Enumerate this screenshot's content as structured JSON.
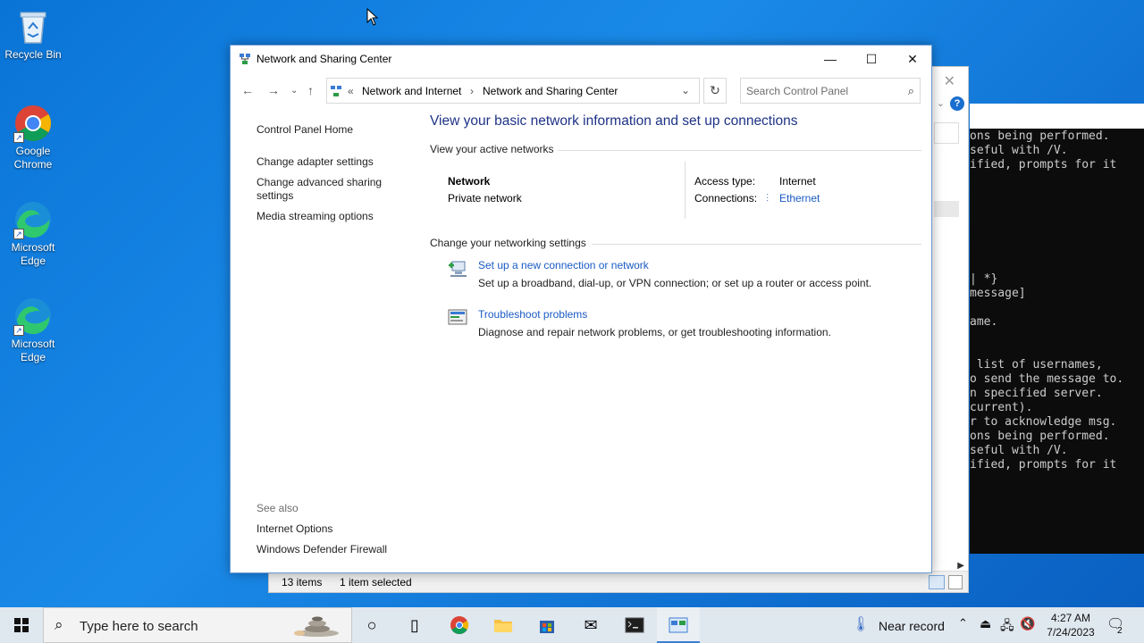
{
  "desktop": {
    "icons": [
      {
        "label": "Recycle Bin"
      },
      {
        "label": "Google Chrome"
      },
      {
        "label": "Microsoft Edge"
      },
      {
        "label": "Microsoft Edge"
      }
    ]
  },
  "console": {
    "lines": [
      "ons being performed.",
      "seful with /V.",
      "ified, prompts for it",
      "| *}",
      "message]",
      "ame.",
      " list of usernames,",
      "o send the message to.",
      "n specified server.",
      "current).",
      "r to acknowledge msg.",
      "ons being performed.",
      "seful with /V.",
      "ified, prompts for it"
    ]
  },
  "background_window": {
    "status_items": "13 items",
    "status_selected": "1 item selected"
  },
  "window": {
    "title": "Network and Sharing Center",
    "breadcrumb": {
      "prefix": "«",
      "parent": "Network and Internet",
      "separator": "›",
      "current": "Network and Sharing Center"
    },
    "search_placeholder": "Search Control Panel",
    "left_pane": {
      "home": "Control Panel Home",
      "links": [
        "Change adapter settings",
        "Change advanced sharing settings",
        "Media streaming options"
      ],
      "see_also_label": "See also",
      "see_also_links": [
        "Internet Options",
        "Windows Defender Firewall"
      ]
    },
    "heading": "View your basic network information and set up connections",
    "active_networks_label": "View your active networks",
    "network": {
      "name": "Network",
      "type": "Private network",
      "access_type_label": "Access type:",
      "access_type_value": "Internet",
      "connections_label": "Connections:",
      "connections_value": "Ethernet"
    },
    "change_settings_label": "Change your networking settings",
    "tasks": [
      {
        "title": "Set up a new connection or network",
        "description": "Set up a broadband, dial-up, or VPN connection; or set up a router or access point."
      },
      {
        "title": "Troubleshoot problems",
        "description": "Diagnose and repair network problems, or get troubleshooting information."
      }
    ]
  },
  "taskbar": {
    "search_placeholder": "Type here to search",
    "weather": "Near record",
    "time": "4:27 AM",
    "date": "7/24/2023",
    "notification_count": "2"
  }
}
